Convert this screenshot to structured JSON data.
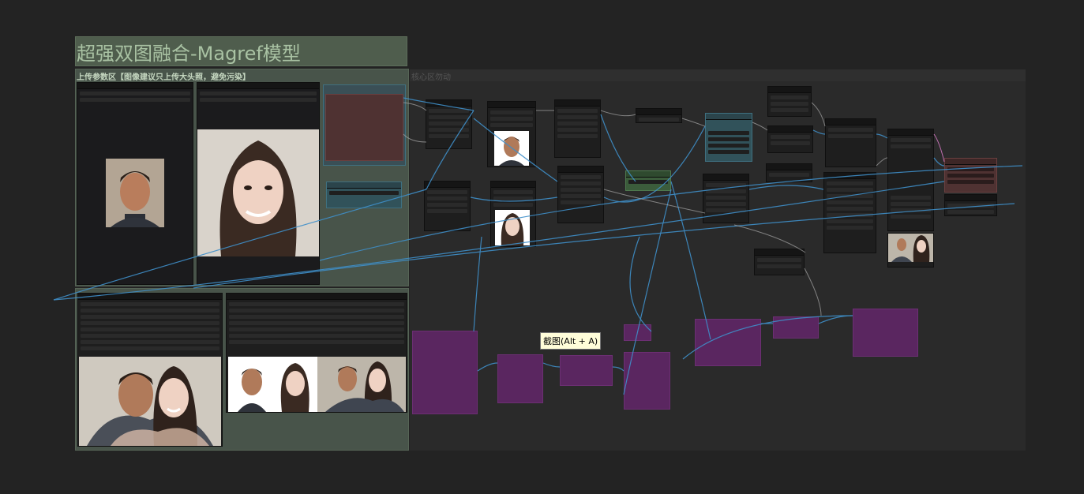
{
  "canvas": {
    "background": "#232323",
    "wire_color": "#3f8fc9"
  },
  "title_panel": {
    "title": "超强双图融合-Magref模型",
    "color": "#4f5d4d"
  },
  "groups": {
    "upload": {
      "label": "上传参数区【图像建议只上传大头照，避免污染】",
      "color": "#48544a"
    },
    "core": {
      "label": "核心区勿动",
      "color": "#2a2a2a"
    }
  },
  "tooltip": {
    "text": "截图(Alt + A)"
  },
  "images": {
    "man_portrait": "man-portrait",
    "woman_portrait": "woman-portrait",
    "couple_result": "couple-photo",
    "comparison": "side-by-side-comparison"
  }
}
